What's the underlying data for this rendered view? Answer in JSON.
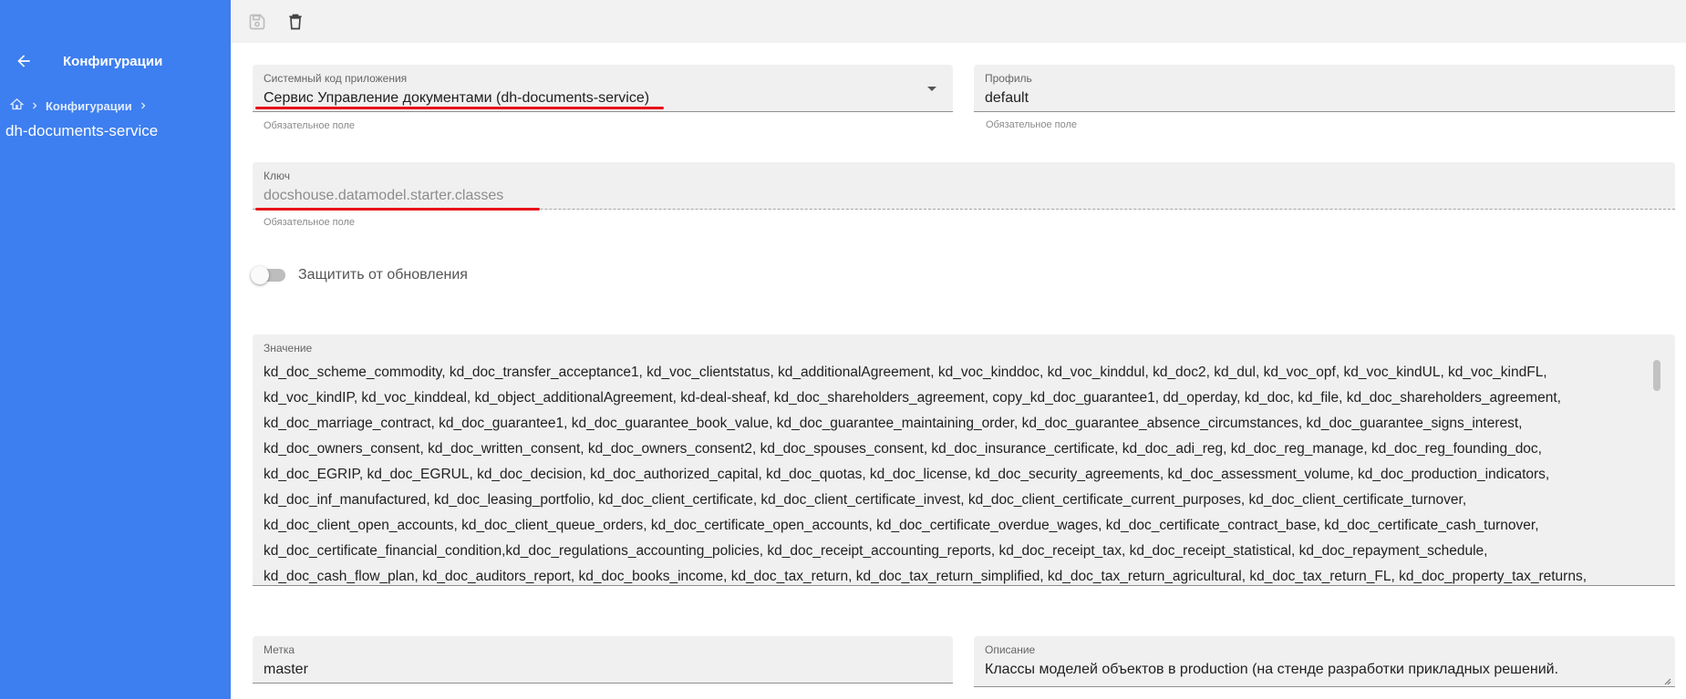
{
  "sidebar": {
    "title": "Конфигурации",
    "breadcrumb": {
      "link": "Конфигурации"
    },
    "current_page": "dh-documents-service"
  },
  "toolbar": {
    "icons": [
      "save-icon",
      "delete-icon"
    ]
  },
  "form": {
    "app_code": {
      "label": "Системный код приложения",
      "value": "Сервис Управление документами (dh-documents-service)",
      "hint": "Обязательное поле"
    },
    "profile": {
      "label": "Профиль",
      "value": "default",
      "hint": "Обязательное поле"
    },
    "key": {
      "label": "Ключ",
      "value": "docshouse.datamodel.starter.classes",
      "hint": "Обязательное поле"
    },
    "protect": {
      "label": "Защитить от обновления",
      "checked": false
    },
    "value": {
      "label": "Значение",
      "text": "kd_doc_scheme_commodity, kd_doc_transfer_acceptance1, kd_voc_clientstatus, kd_additionalAgreement, kd_voc_kinddoc, kd_voc_kinddul, kd_doc2, kd_dul, kd_voc_opf, kd_voc_kindUL, kd_voc_kindFL,\nkd_voc_kindIP,  kd_voc_kinddeal, kd_object_additionalAgreement,  kd-deal-sheaf,  kd_doc_shareholders_agreement, copy_kd_doc_guarantee1, dd_operday, kd_doc, kd_file, kd_doc_shareholders_agreement,\nkd_doc_marriage_contract, kd_doc_guarantee1, kd_doc_guarantee_book_value, kd_doc_guarantee_maintaining_order, kd_doc_guarantee_absence_circumstances, kd_doc_guarantee_signs_interest,\nkd_doc_owners_consent, kd_doc_written_consent, kd_doc_owners_consent2, kd_doc_spouses_consent, kd_doc_insurance_certificate, kd_doc_adi_reg, kd_doc_reg_manage, kd_doc_reg_founding_doc,\nkd_doc_EGRIP, kd_doc_EGRUL, kd_doc_decision, kd_doc_authorized_capital, kd_doc_quotas, kd_doc_license, kd_doc_security_agreements, kd_doc_assessment_volume, kd_doc_production_indicators,\nkd_doc_inf_manufactured, kd_doc_leasing_portfolio, kd_doc_client_certificate, kd_doc_client_certificate_invest, kd_doc_client_certificate_current_purposes, kd_doc_client_certificate_turnover,\nkd_doc_client_open_accounts, kd_doc_client_queue_orders, kd_doc_certificate_open_accounts, kd_doc_certificate_overdue_wages, kd_doc_certificate_contract_base, kd_doc_certificate_cash_turnover,\nkd_doc_certificate_financial_condition,kd_doc_regulations_accounting_policies, kd_doc_receipt_accounting_reports, kd_doc_receipt_tax, kd_doc_receipt_statistical, kd_doc_repayment_schedule,\nkd_doc_cash_flow_plan, kd_doc_auditors_report, kd_doc_books_income, kd_doc_tax_return, kd_doc_tax_return_simplified, kd_doc_tax_return_agricultural, kd_doc_tax_return_FL, kd_doc_property_tax_returns,"
    },
    "tag": {
      "label": "Метка",
      "value": "master"
    },
    "description": {
      "label": "Описание",
      "value": "Классы моделей объектов в production (на стенде разработки прикладных решений."
    }
  },
  "colors": {
    "sidebar": "#3d7ef0",
    "annotation": "#e8131a"
  }
}
